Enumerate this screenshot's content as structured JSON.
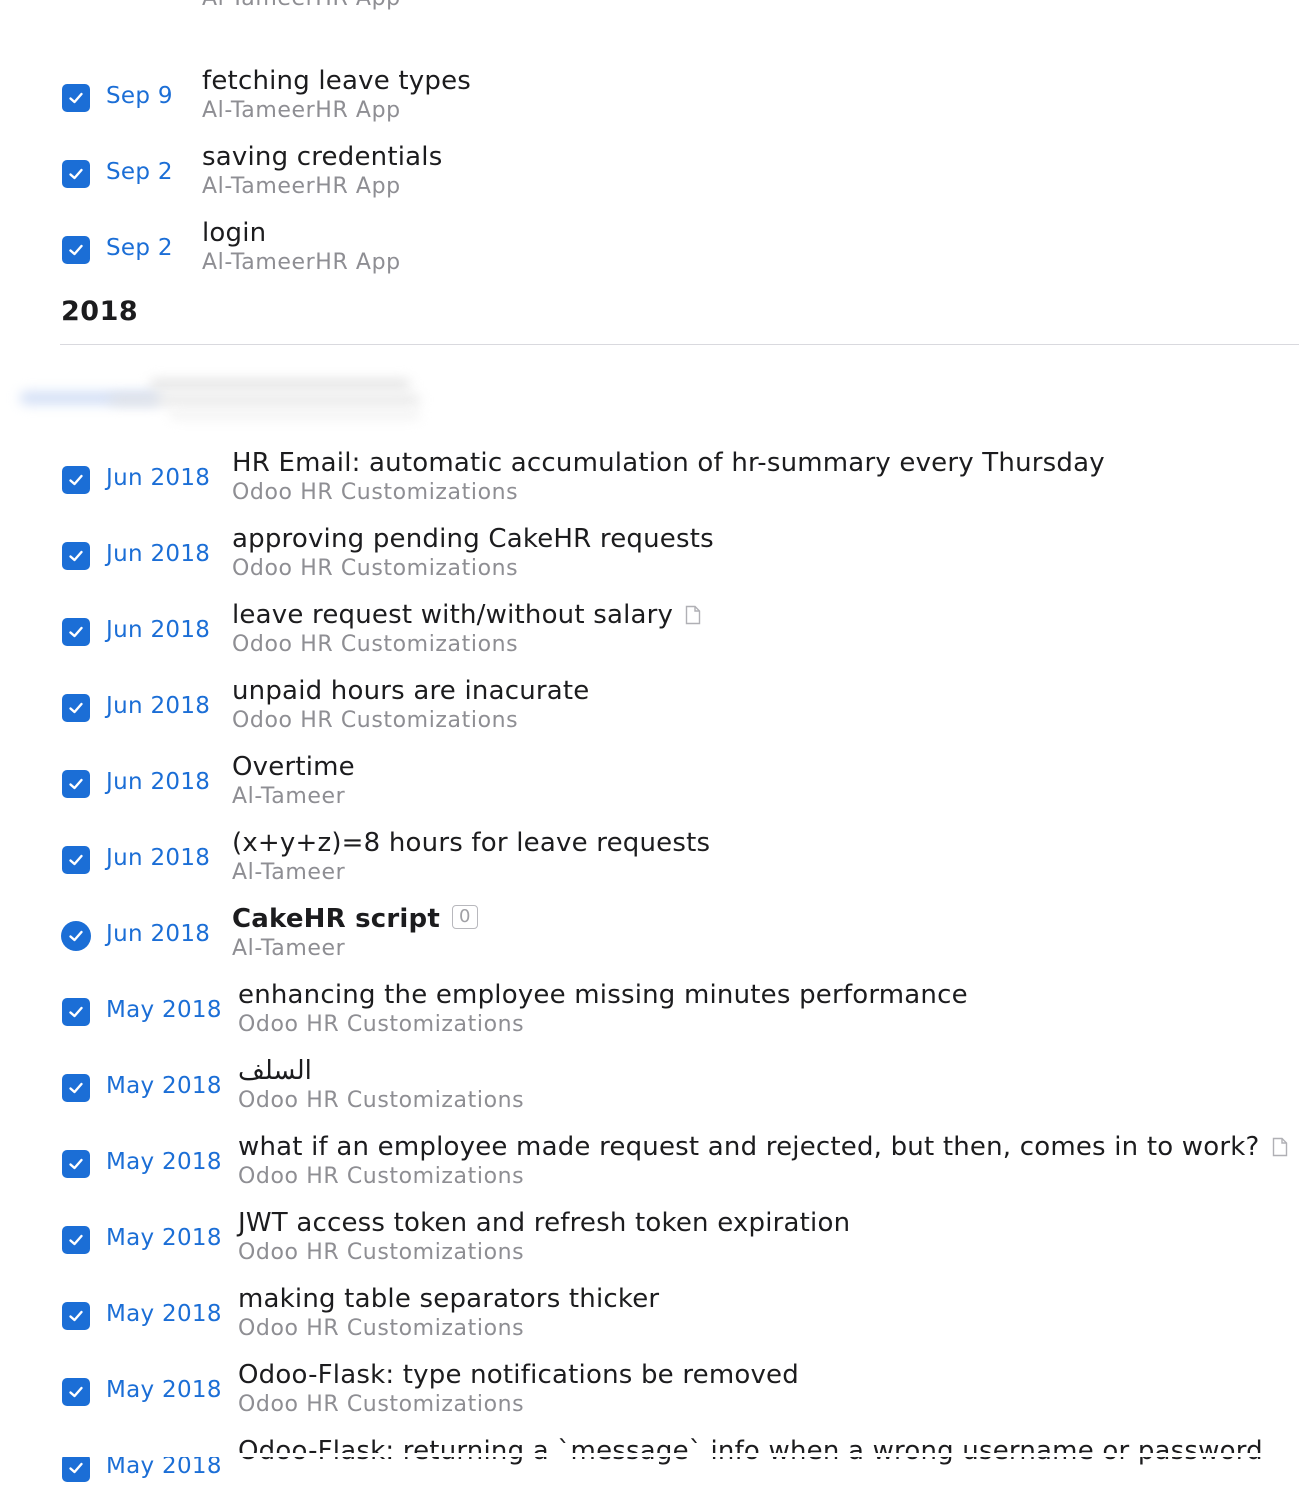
{
  "section_year": "2018",
  "top_items": [
    {
      "date": "",
      "title": "",
      "project": "Al-TameerHR App",
      "partial": true
    },
    {
      "date": "Sep 9",
      "title": "fetching leave types",
      "project": "Al-TameerHR App"
    },
    {
      "date": "Sep 2",
      "title": "saving credentials",
      "project": "Al-TameerHR App"
    },
    {
      "date": "Sep 2",
      "title": "login",
      "project": "Al-TameerHR App"
    }
  ],
  "items_2018": [
    {
      "date": "Jun 2018",
      "title": "HR Email: automatic accumulation of hr-summary every  Thursday",
      "project": "Odoo HR Customizations"
    },
    {
      "date": "Jun 2018",
      "title": "approving pending CakeHR requests",
      "project": "Odoo HR Customizations"
    },
    {
      "date": "Jun 2018",
      "title": "leave request with/without salary",
      "project": "Odoo HR Customizations",
      "has_note": true
    },
    {
      "date": "Jun 2018",
      "title": "unpaid hours are inacurate",
      "project": "Odoo HR Customizations"
    },
    {
      "date": "Jun 2018",
      "title": "Overtime",
      "project": "Al-Tameer"
    },
    {
      "date": "Jun 2018",
      "title": "(x+y+z)=8 hours for leave requests",
      "project": "Al-Tameer"
    },
    {
      "date": "Jun 2018",
      "title": "CakeHR script",
      "project": "Al-Tameer",
      "is_project": true,
      "badge": "0"
    },
    {
      "date": "May 2018",
      "title": "enhancing the employee missing minutes performance",
      "project": "Odoo HR Customizations"
    },
    {
      "date": "May 2018",
      "title": "السلف",
      "project": "Odoo HR Customizations"
    },
    {
      "date": "May 2018",
      "title": "what if an employee made request and rejected, but then, comes in to work?",
      "project": "Odoo HR Customizations",
      "has_note": true
    },
    {
      "date": "May 2018",
      "title": "JWT access token and refresh token expiration",
      "project": "Odoo HR Customizations"
    },
    {
      "date": "May 2018",
      "title": "making table separators thicker",
      "project": "Odoo HR Customizations"
    },
    {
      "date": "May 2018",
      "title": "Odoo-Flask: type notifications be removed",
      "project": "Odoo HR Customizations"
    },
    {
      "date": "May 2018",
      "title": "Odoo-Flask: returning a `message` info when a wrong username or password",
      "project": "",
      "partial": true
    }
  ],
  "colors": {
    "accent": "#1b6ed6",
    "title": "#1c1c1e",
    "subtitle": "#8e8e93",
    "divider": "#d9d9de"
  },
  "icons": {
    "checkbox": "checked-checkbox-icon",
    "project_check": "checked-circle-icon",
    "note": "note-icon"
  }
}
